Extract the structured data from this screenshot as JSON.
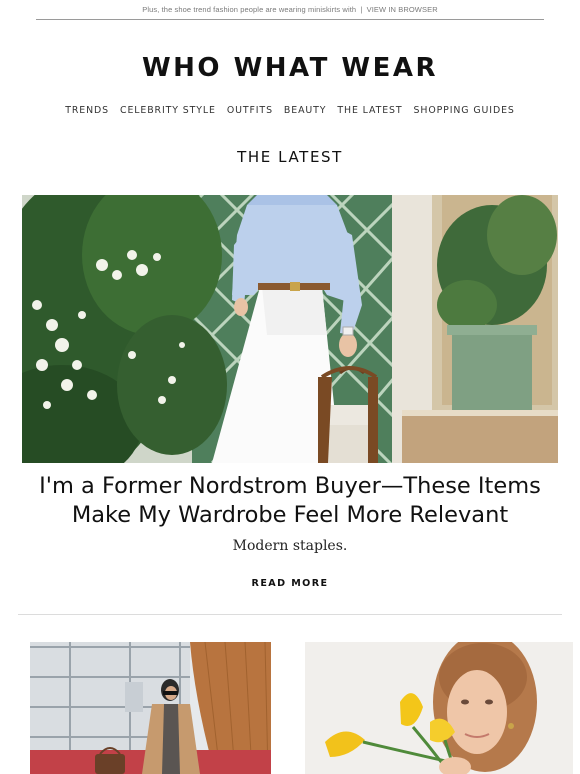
{
  "preheader": {
    "text": "Plus, the shoe trend fashion people are wearing miniskirts with",
    "separator": "|",
    "view_in_browser": "VIEW IN BROWSER"
  },
  "brand": {
    "logo_text": "WHO WHAT WEAR"
  },
  "nav": {
    "items": [
      "TRENDS",
      "CELEBRITY STYLE",
      "OUTFITS",
      "BEAUTY",
      "THE LATEST",
      "SHOPPING GUIDES"
    ]
  },
  "section": {
    "title": "THE LATEST"
  },
  "feature": {
    "headline_line1": "I'm a Former Nordstrom Buyer—These Items",
    "headline_line2": "Make My Wardrobe Feel More Relevant",
    "dek": "Modern staples.",
    "cta": "READ MORE"
  },
  "colors": {
    "text": "#111111",
    "muted": "#7a7a7a",
    "rule": "#dcdcdc",
    "trellis_green": "#4f7f5c"
  }
}
